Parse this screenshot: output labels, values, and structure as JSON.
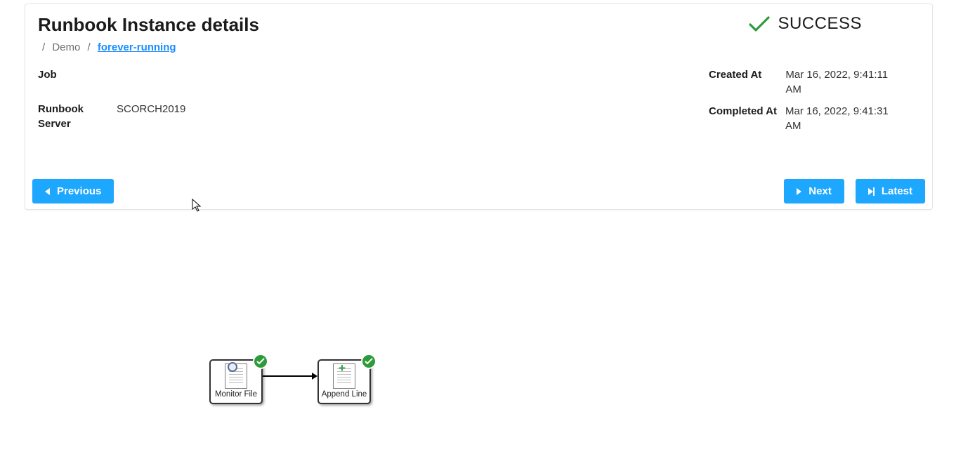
{
  "header": {
    "title": "Runbook Instance details",
    "breadcrumb": {
      "level1": "Demo",
      "level2": "forever-running"
    }
  },
  "status": {
    "label": "SUCCESS"
  },
  "details": {
    "job_label": "Job",
    "job_value": "",
    "server_label": "Runbook Server",
    "server_value": "SCORCH2019",
    "created_label": "Created At",
    "created_value": "Mar 16, 2022, 9:41:11 AM",
    "completed_label": "Completed At",
    "completed_value": "Mar 16, 2022, 9:41:31 AM"
  },
  "buttons": {
    "previous": "Previous",
    "next": "Next",
    "latest": "Latest"
  },
  "workflow": {
    "nodes": [
      {
        "id": "monitor-file",
        "label": "Monitor File",
        "status": "success",
        "icon": "monitor-doc"
      },
      {
        "id": "append-line",
        "label": "Append Line",
        "status": "success",
        "icon": "append-doc"
      }
    ]
  }
}
